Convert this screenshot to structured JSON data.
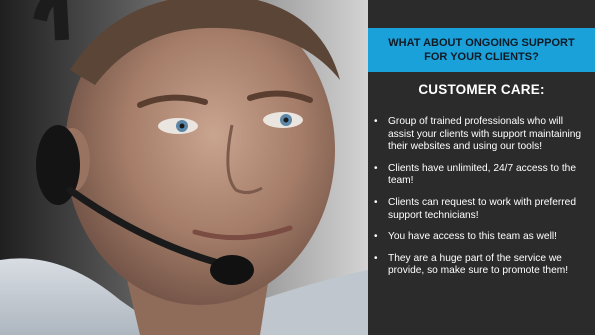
{
  "slide": {
    "header": "WHAT ABOUT ONGOING SUPPORT FOR YOUR CLIENTS?",
    "section_title": "CUSTOMER CARE:",
    "bullet_symbol": "•",
    "bullets": [
      "Group of trained professionals who will assist your clients with support maintaining their websites and using our tools!",
      "Clients have unlimited, 24/7 access to the team!",
      "Clients can request to work with preferred support technicians!",
      "You have access to this team as well!",
      "They are a huge part of the service we provide, so make sure to promote them!"
    ]
  },
  "colors": {
    "panel_background": "#2b2b2b",
    "header_background": "#1ba1d9",
    "header_text": "#0f1a25",
    "body_text": "#ffffff"
  },
  "image": {
    "subject": "support-agent-with-headset-photo"
  }
}
